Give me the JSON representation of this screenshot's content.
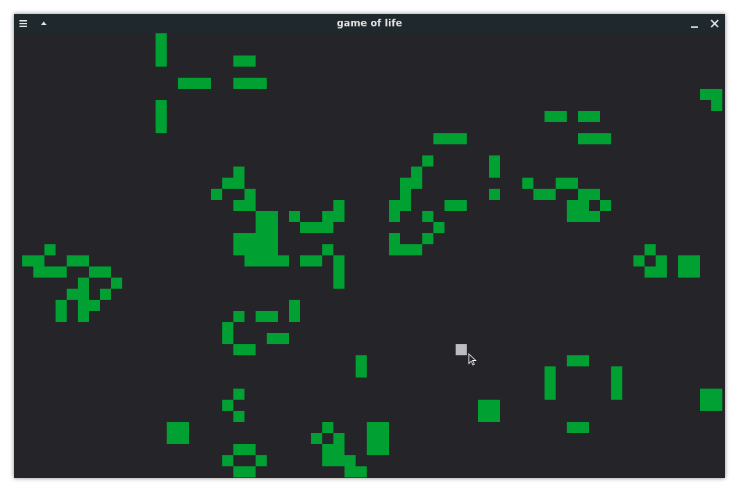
{
  "window": {
    "title": "game of life",
    "menu_icon": "hamburger-menu-icon",
    "shade_icon": "triangle-up-icon",
    "minimize_icon": "minimize-icon",
    "close_icon": "close-icon"
  },
  "board": {
    "cell_color": "#00a032",
    "background_color": "#252529",
    "cursor_color": "#bdbdbd",
    "live_cells": [
      [
        13,
        0
      ],
      [
        13,
        1
      ],
      [
        13,
        2
      ],
      [
        20,
        2
      ],
      [
        21,
        2
      ],
      [
        15,
        4
      ],
      [
        16,
        4
      ],
      [
        17,
        4
      ],
      [
        20,
        4
      ],
      [
        21,
        4
      ],
      [
        22,
        4
      ],
      [
        13,
        6
      ],
      [
        13,
        7
      ],
      [
        13,
        8
      ],
      [
        62,
        5
      ],
      [
        63,
        5
      ],
      [
        63,
        6
      ],
      [
        48,
        7
      ],
      [
        49,
        7
      ],
      [
        51,
        7
      ],
      [
        52,
        7
      ],
      [
        38,
        9
      ],
      [
        39,
        9
      ],
      [
        40,
        9
      ],
      [
        51,
        9
      ],
      [
        52,
        9
      ],
      [
        53,
        9
      ],
      [
        37,
        11
      ],
      [
        43,
        11
      ],
      [
        20,
        12
      ],
      [
        36,
        12
      ],
      [
        43,
        12
      ],
      [
        19,
        13
      ],
      [
        20,
        13
      ],
      [
        35,
        13
      ],
      [
        36,
        13
      ],
      [
        46,
        13
      ],
      [
        49,
        13
      ],
      [
        50,
        13
      ],
      [
        18,
        14
      ],
      [
        21,
        14
      ],
      [
        35,
        14
      ],
      [
        43,
        14
      ],
      [
        47,
        14
      ],
      [
        48,
        14
      ],
      [
        51,
        14
      ],
      [
        52,
        14
      ],
      [
        20,
        15
      ],
      [
        21,
        15
      ],
      [
        29,
        15
      ],
      [
        34,
        15
      ],
      [
        35,
        15
      ],
      [
        39,
        15
      ],
      [
        40,
        15
      ],
      [
        50,
        15
      ],
      [
        51,
        15
      ],
      [
        53,
        15
      ],
      [
        22,
        16
      ],
      [
        23,
        16
      ],
      [
        25,
        16
      ],
      [
        28,
        16
      ],
      [
        29,
        16
      ],
      [
        34,
        16
      ],
      [
        37,
        16
      ],
      [
        50,
        16
      ],
      [
        51,
        16
      ],
      [
        52,
        16
      ],
      [
        22,
        17
      ],
      [
        23,
        17
      ],
      [
        26,
        17
      ],
      [
        27,
        17
      ],
      [
        28,
        17
      ],
      [
        38,
        17
      ],
      [
        20,
        18
      ],
      [
        21,
        18
      ],
      [
        22,
        18
      ],
      [
        23,
        18
      ],
      [
        34,
        18
      ],
      [
        37,
        18
      ],
      [
        3,
        19
      ],
      [
        20,
        19
      ],
      [
        21,
        19
      ],
      [
        22,
        19
      ],
      [
        23,
        19
      ],
      [
        28,
        19
      ],
      [
        34,
        19
      ],
      [
        35,
        19
      ],
      [
        36,
        19
      ],
      [
        57,
        19
      ],
      [
        1,
        20
      ],
      [
        2,
        20
      ],
      [
        5,
        20
      ],
      [
        6,
        20
      ],
      [
        21,
        20
      ],
      [
        22,
        20
      ],
      [
        23,
        20
      ],
      [
        24,
        20
      ],
      [
        26,
        20
      ],
      [
        27,
        20
      ],
      [
        29,
        20
      ],
      [
        56,
        20
      ],
      [
        58,
        20
      ],
      [
        60,
        20
      ],
      [
        61,
        20
      ],
      [
        2,
        21
      ],
      [
        3,
        21
      ],
      [
        4,
        21
      ],
      [
        7,
        21
      ],
      [
        8,
        21
      ],
      [
        29,
        21
      ],
      [
        57,
        21
      ],
      [
        58,
        21
      ],
      [
        60,
        21
      ],
      [
        61,
        21
      ],
      [
        6,
        22
      ],
      [
        9,
        22
      ],
      [
        29,
        22
      ],
      [
        5,
        23
      ],
      [
        6,
        23
      ],
      [
        8,
        23
      ],
      [
        4,
        24
      ],
      [
        6,
        24
      ],
      [
        7,
        24
      ],
      [
        25,
        24
      ],
      [
        4,
        25
      ],
      [
        6,
        25
      ],
      [
        20,
        25
      ],
      [
        22,
        25
      ],
      [
        23,
        25
      ],
      [
        25,
        25
      ],
      [
        19,
        26
      ],
      [
        19,
        27
      ],
      [
        23,
        27
      ],
      [
        24,
        27
      ],
      [
        20,
        28
      ],
      [
        21,
        28
      ],
      [
        31,
        29
      ],
      [
        50,
        29
      ],
      [
        51,
        29
      ],
      [
        31,
        30
      ],
      [
        48,
        30
      ],
      [
        54,
        30
      ],
      [
        48,
        31
      ],
      [
        54,
        31
      ],
      [
        20,
        32
      ],
      [
        48,
        32
      ],
      [
        54,
        32
      ],
      [
        62,
        32
      ],
      [
        63,
        32
      ],
      [
        19,
        33
      ],
      [
        42,
        33
      ],
      [
        43,
        33
      ],
      [
        62,
        33
      ],
      [
        63,
        33
      ],
      [
        20,
        34
      ],
      [
        42,
        34
      ],
      [
        43,
        34
      ],
      [
        14,
        35
      ],
      [
        15,
        35
      ],
      [
        28,
        35
      ],
      [
        32,
        35
      ],
      [
        33,
        35
      ],
      [
        50,
        35
      ],
      [
        51,
        35
      ],
      [
        14,
        36
      ],
      [
        15,
        36
      ],
      [
        27,
        36
      ],
      [
        29,
        36
      ],
      [
        32,
        36
      ],
      [
        33,
        36
      ],
      [
        20,
        37
      ],
      [
        21,
        37
      ],
      [
        28,
        37
      ],
      [
        29,
        37
      ],
      [
        32,
        37
      ],
      [
        33,
        37
      ],
      [
        19,
        38
      ],
      [
        22,
        38
      ],
      [
        28,
        38
      ],
      [
        29,
        38
      ],
      [
        30,
        38
      ],
      [
        20,
        39
      ],
      [
        21,
        39
      ],
      [
        30,
        39
      ],
      [
        31,
        39
      ]
    ],
    "cursor_cell": [
      40,
      28
    ]
  }
}
